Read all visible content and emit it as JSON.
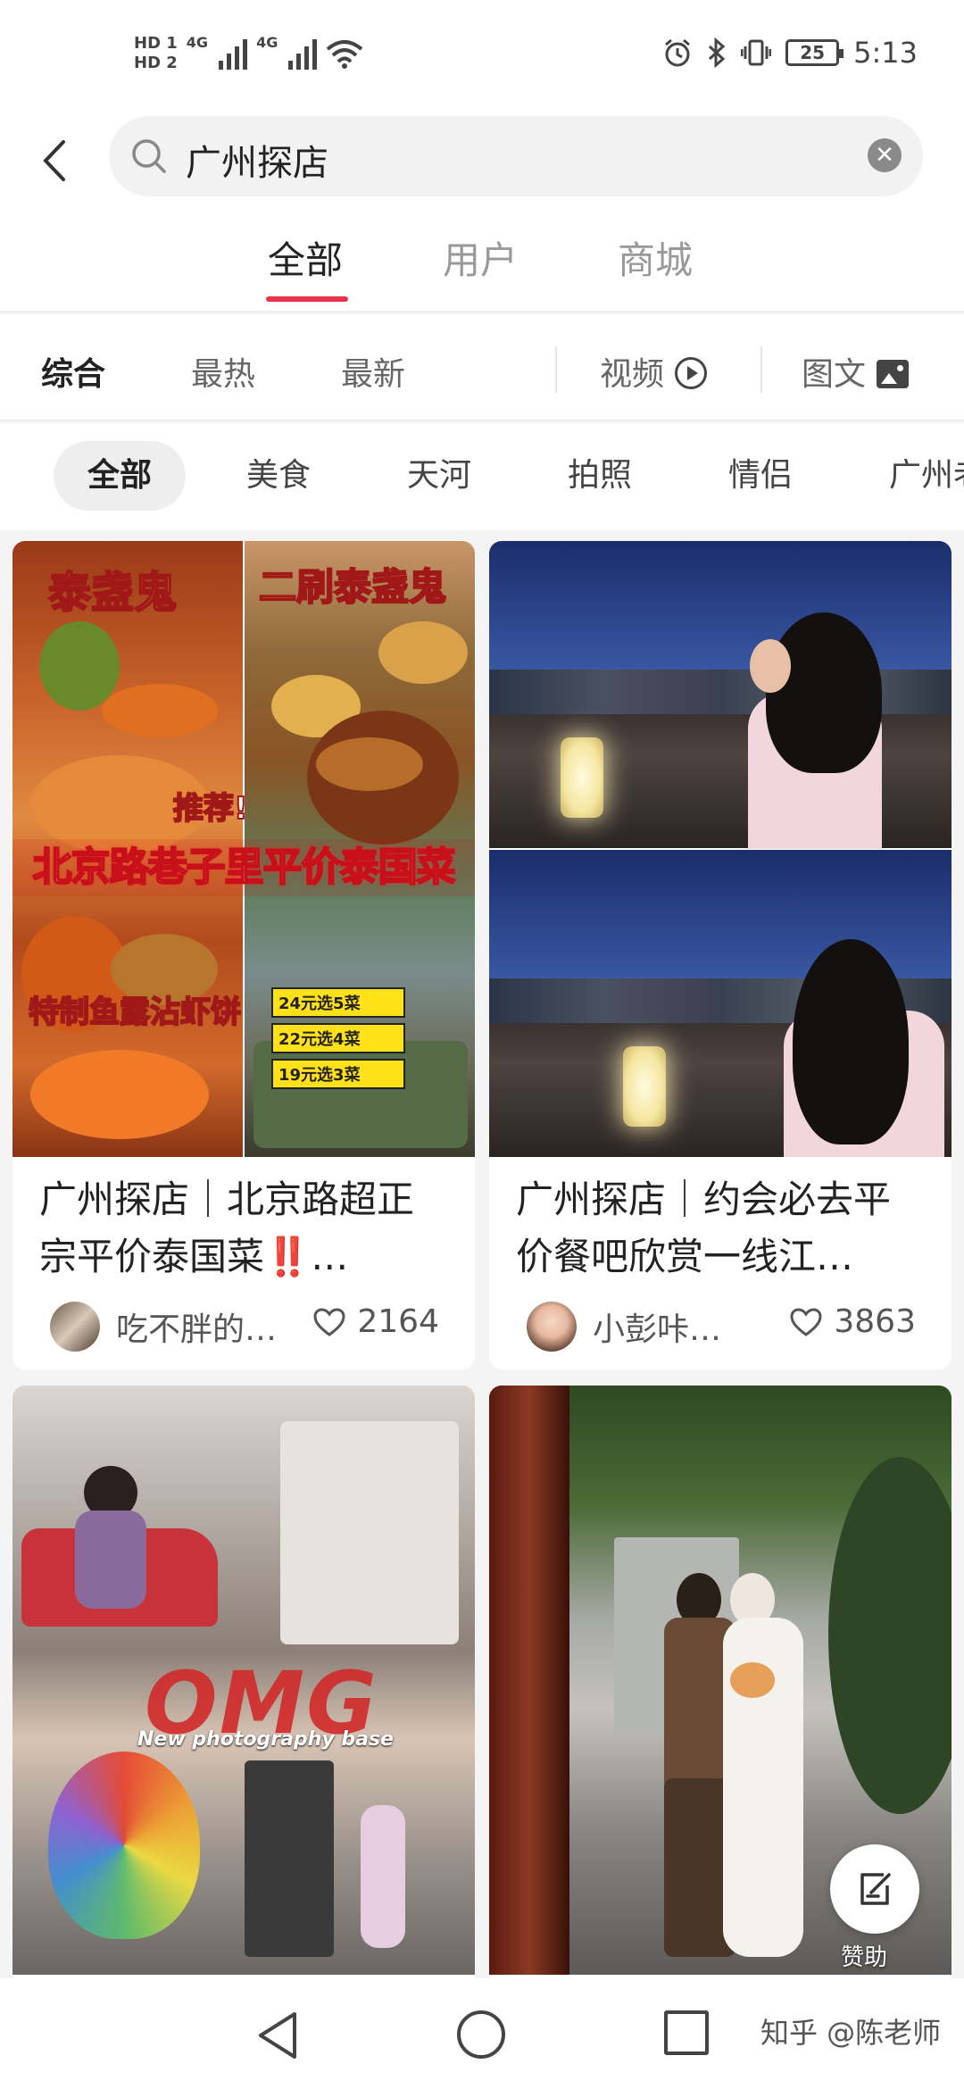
{
  "status_bar": {
    "hd1": "HD 1",
    "hd2": "HD 2",
    "net1": "4G",
    "net2": "4G",
    "battery": "25",
    "time": "5:13"
  },
  "search": {
    "query": "广州探店"
  },
  "top_tabs": [
    {
      "label": "全部",
      "active": true
    },
    {
      "label": "用户",
      "active": false
    },
    {
      "label": "商城",
      "active": false
    }
  ],
  "sort": {
    "items": [
      "综合",
      "最热",
      "最新"
    ],
    "video": "视频",
    "image_text": "图文"
  },
  "filters": [
    "全部",
    "美食",
    "天河",
    "拍照",
    "情侣",
    "广州老"
  ],
  "cards": [
    {
      "title_line1": "广州探店｜北京路超正",
      "title_line2": "宗平价泰国菜‼️…",
      "author": "吃不胖的…",
      "likes": "2164",
      "cover_text": {
        "tag_left": "泰盏鬼",
        "tag_right": "二刷泰盏鬼",
        "recommend": "推荐!",
        "banner": "北京路巷子里平价泰国菜",
        "dish": "特制鱼露沾虾饼",
        "price_1": "24元选5菜",
        "price_2": "22元选4菜",
        "price_3": "19元选3菜"
      }
    },
    {
      "title_line1": "广州探店｜约会必去平",
      "title_line2": "价餐吧欣赏一线江…",
      "author": "小彭咔…",
      "likes": "3863"
    },
    {
      "cover_text": {
        "brand": "OMG",
        "subtitle": "New photography base"
      }
    },
    {}
  ],
  "float_button": {
    "label": "赞助"
  },
  "watermark": "知乎 @陈老师"
}
